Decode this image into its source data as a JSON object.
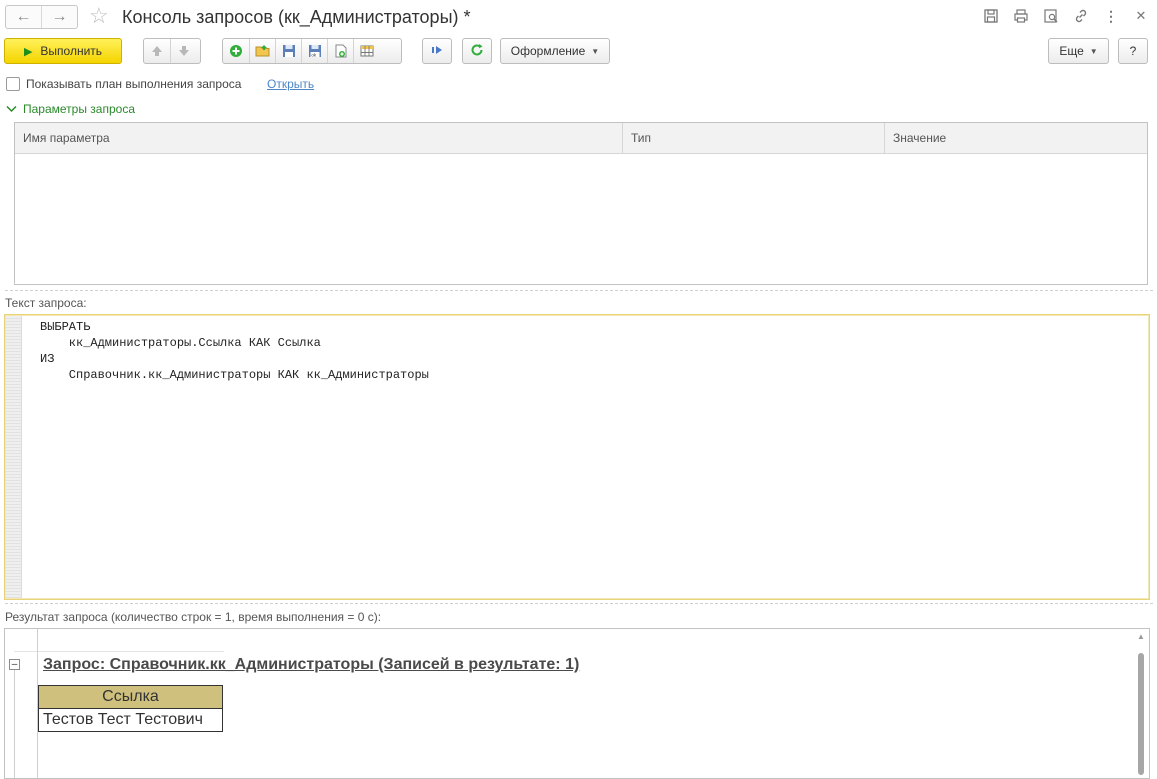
{
  "window": {
    "title": "Консоль запросов (кк_Администраторы) *",
    "icons": [
      "back-arrow-icon",
      "forward-arrow-icon",
      "favorite-star-icon",
      "save-icon",
      "print-icon",
      "preview-icon",
      "link-icon",
      "more-vertical-icon",
      "close-icon"
    ]
  },
  "toolbar": {
    "execute_label": "Выполнить",
    "design_label": "Оформление",
    "more_label": "Еще",
    "help_label": "?"
  },
  "options": {
    "show_plan_label": "Показывать план выполнения запроса",
    "open_link": "Открыть"
  },
  "params": {
    "group_title": "Параметры запроса",
    "columns": [
      "Имя параметра",
      "Тип",
      "Значение"
    ]
  },
  "query": {
    "label": "Текст запроса:",
    "text": "ВЫБРАТЬ\n    кк_Администраторы.Ссылка КАК Ссылка\nИЗ\n    Справочник.кк_Администраторы КАК кк_Администраторы"
  },
  "result": {
    "label": "Результат запроса (количество строк = 1, время выполнения = 0 с):",
    "header": "Запрос: Справочник.кк_Администраторы (Записей в результате: 1)",
    "column": "Ссылка",
    "rows": [
      "Тестов Тест Тестович"
    ],
    "header_color": "#cfc17d"
  },
  "colors": {
    "accent_yellow": "#f5d400",
    "group_green": "#2a8a2a",
    "link_blue": "#4d86c5",
    "editor_border": "#e8d27a"
  }
}
